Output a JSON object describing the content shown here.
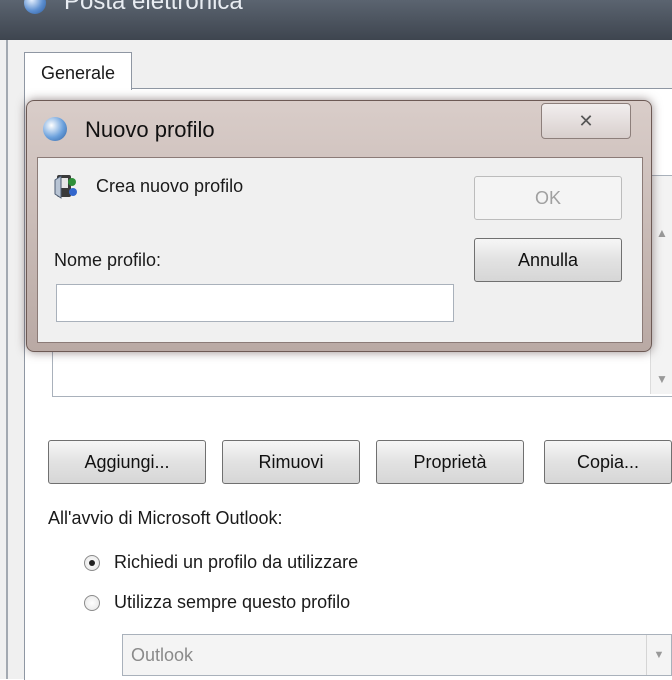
{
  "window": {
    "title": "Posta elettronica"
  },
  "tabs": [
    {
      "label": "Generale"
    }
  ],
  "profile_buttons": {
    "add": "Aggiungi...",
    "remove": "Rimuovi",
    "properties": "Proprietà",
    "copy": "Copia..."
  },
  "startup": {
    "label": "All'avvio di Microsoft Outlook:",
    "options": [
      {
        "label": "Richiedi un profilo da utilizzare",
        "selected": true
      },
      {
        "label": "Utilizza sempre questo profilo",
        "selected": false
      }
    ],
    "profile_select_value": "Outlook"
  },
  "dialog": {
    "title": "Nuovo profilo",
    "close_symbol": "✕",
    "description": "Crea nuovo profilo",
    "name_label": "Nome profilo:",
    "name_value": "",
    "ok_label": "OK",
    "cancel_label": "Annulla"
  },
  "colors": {
    "dialog_frame": "#c8b9b4",
    "titlebar": "#4a525d"
  },
  "icons": {
    "window": "mail-globe-icon",
    "dialog": "globe-icon",
    "profile": "profile-wizard-icon"
  }
}
